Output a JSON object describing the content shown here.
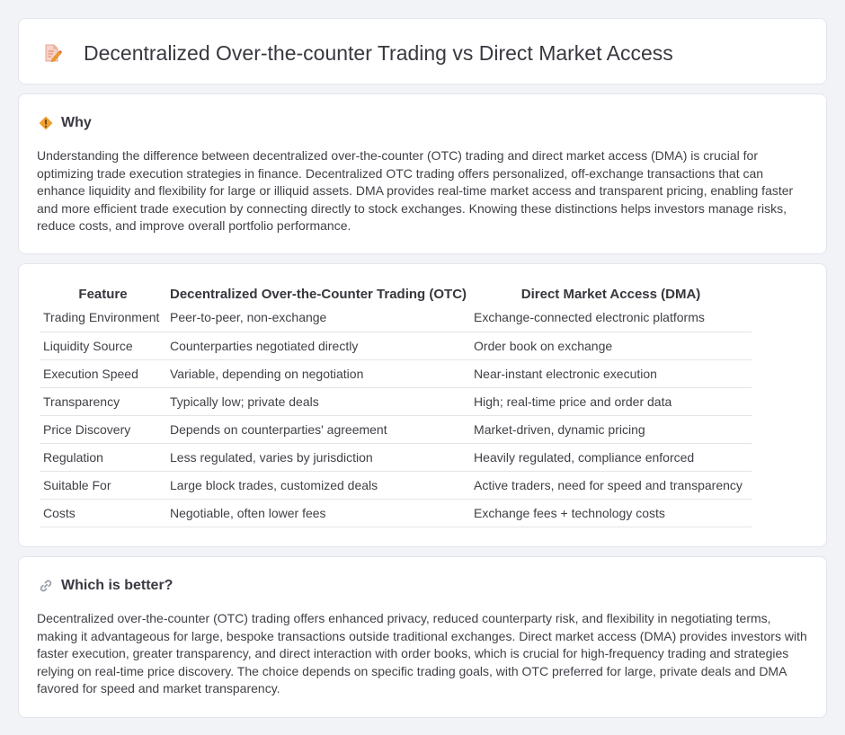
{
  "header": {
    "title": "Decentralized Over-the-counter Trading vs Direct Market Access",
    "icon": "document-pen-icon"
  },
  "why": {
    "title": "Why",
    "icon": "diamond-warning-icon",
    "text": "Understanding the difference between decentralized over-the-counter (OTC) trading and direct market access (DMA) is crucial for optimizing trade execution strategies in finance. Decentralized OTC trading offers personalized, off-exchange transactions that can enhance liquidity and flexibility for large or illiquid assets. DMA provides real-time market access and transparent pricing, enabling faster and more efficient trade execution by connecting directly to stock exchanges. Knowing these distinctions helps investors manage risks, reduce costs, and improve overall portfolio performance."
  },
  "table": {
    "headers": [
      "Feature",
      "Decentralized Over-the-Counter Trading (OTC)",
      "Direct Market Access (DMA)"
    ],
    "rows": [
      [
        "Trading Environment",
        "Peer-to-peer, non-exchange",
        "Exchange-connected electronic platforms"
      ],
      [
        "Liquidity Source",
        "Counterparties negotiated directly",
        "Order book on exchange"
      ],
      [
        "Execution Speed",
        "Variable, depending on negotiation",
        "Near-instant electronic execution"
      ],
      [
        "Transparency",
        "Typically low; private deals",
        "High; real-time price and order data"
      ],
      [
        "Price Discovery",
        "Depends on counterparties' agreement",
        "Market-driven, dynamic pricing"
      ],
      [
        "Regulation",
        "Less regulated, varies by jurisdiction",
        "Heavily regulated, compliance enforced"
      ],
      [
        "Suitable For",
        "Large block trades, customized deals",
        "Active traders, need for speed and transparency"
      ],
      [
        "Costs",
        "Negotiable, often lower fees",
        "Exchange fees + technology costs"
      ]
    ]
  },
  "better": {
    "title": "Which is better?",
    "icon": "link-icon",
    "text": "Decentralized over-the-counter (OTC) trading offers enhanced privacy, reduced counterparty risk, and flexibility in negotiating terms, making it advantageous for large, bespoke transactions outside traditional exchanges. Direct market access (DMA) provides investors with faster execution, greater transparency, and direct interaction with order books, which is crucial for high-frequency trading and strategies relying on real-time price discovery. The choice depends on specific trading goals, with OTC preferred for large, private deals and DMA favored for speed and market transparency."
  },
  "colors": {
    "background": "#f1f3f7",
    "card": "#ffffff",
    "accent_orange": "#f0a030",
    "text": "#3f3f46"
  }
}
